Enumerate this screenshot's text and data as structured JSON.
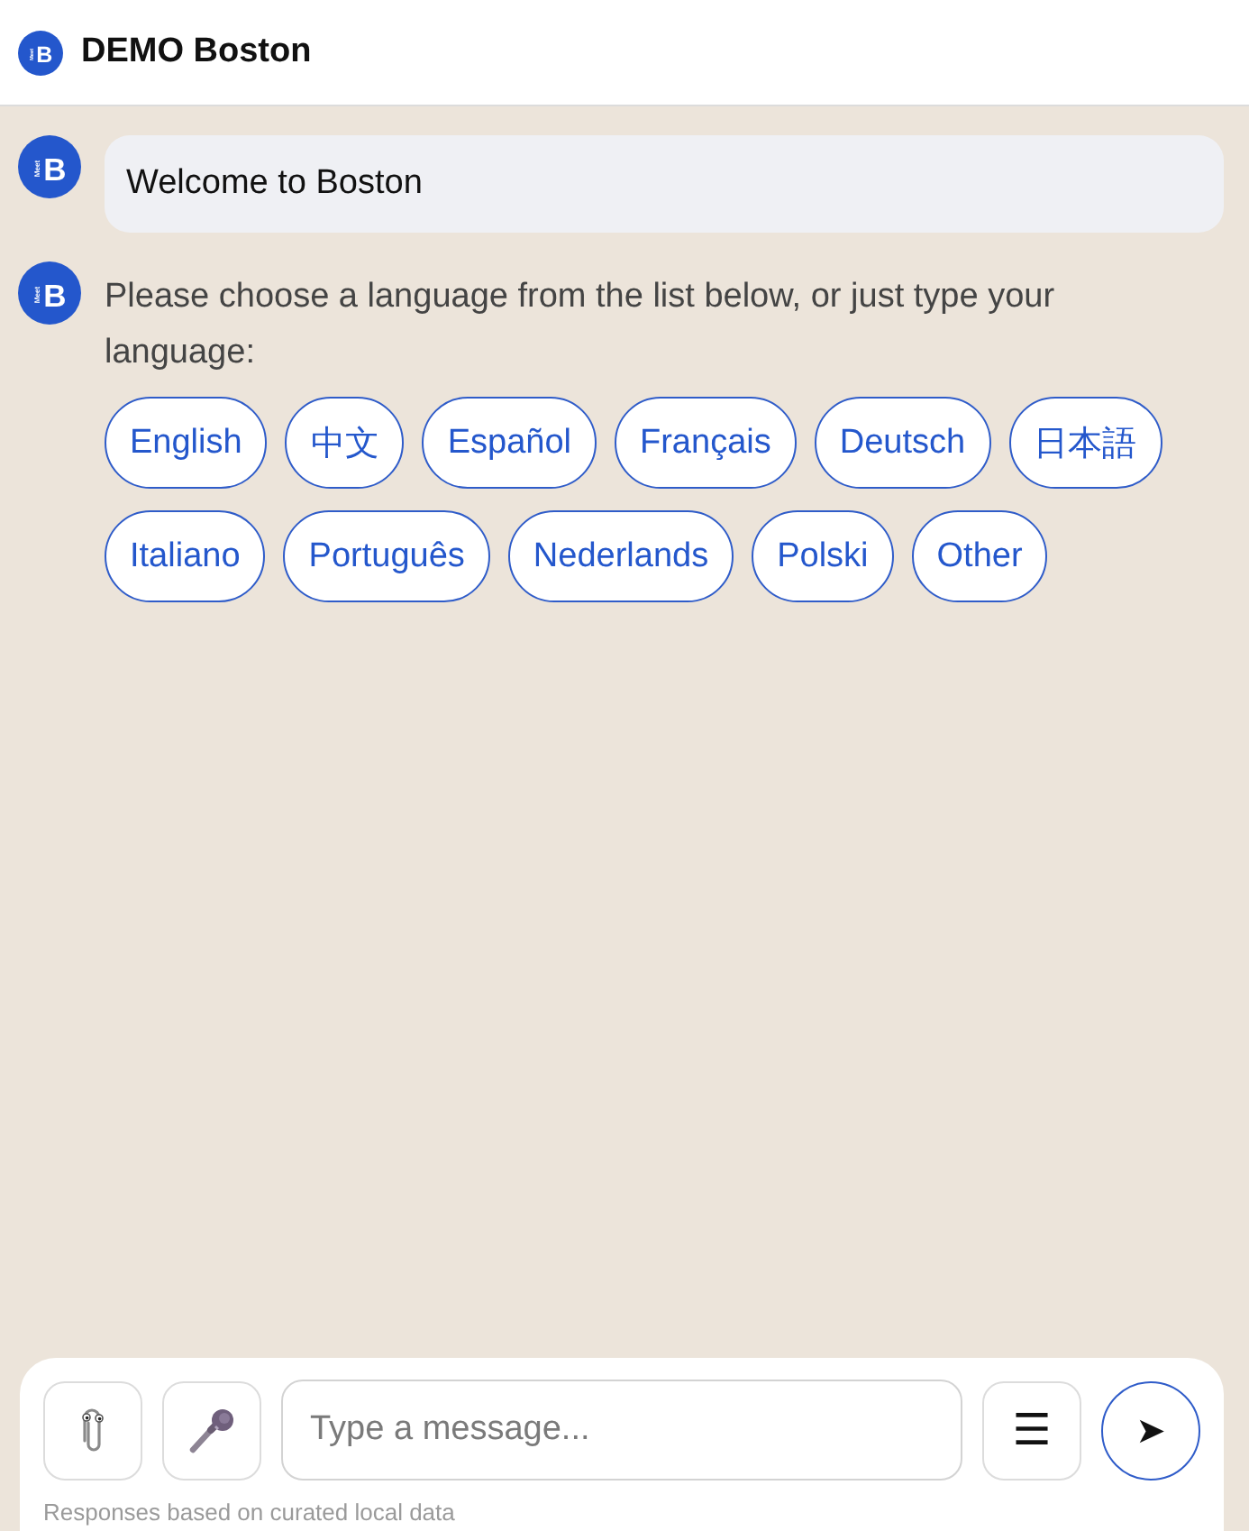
{
  "header": {
    "logo": {
      "letter": "B",
      "word": "Meet"
    },
    "title": "DEMO Boston"
  },
  "messages": [
    {
      "kind": "bubble",
      "avatar": {
        "letter": "B",
        "word": "Meet"
      },
      "text": "Welcome to Boston"
    },
    {
      "kind": "plain",
      "avatar": {
        "letter": "B",
        "word": "Meet"
      },
      "text": "Please choose a language from the list below, or just type your language:",
      "options": [
        "English",
        "中文",
        "Español",
        "Français",
        "Deutsch",
        "日本語",
        "Italiano",
        "Português",
        "Nederlands",
        "Polski",
        "Other"
      ]
    }
  ],
  "composer": {
    "placeholder": "Type a message...",
    "menu_button": "☰",
    "send_button": "➤"
  },
  "footer_note": "Responses based on curated local data"
}
